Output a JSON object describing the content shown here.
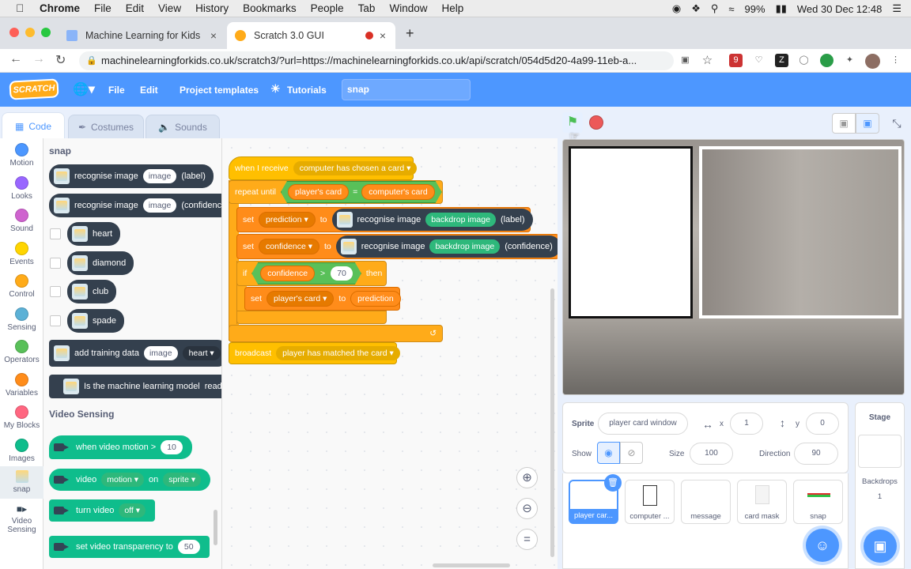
{
  "mac": {
    "apple": "",
    "app": "Chrome",
    "menus": [
      "File",
      "Edit",
      "View",
      "History",
      "Bookmarks",
      "People",
      "Tab",
      "Window",
      "Help"
    ],
    "battery": "99%",
    "clock": "Wed 30 Dec  12:48"
  },
  "browser": {
    "tabs": [
      {
        "title": "Machine Learning for Kids"
      },
      {
        "title": "Scratch 3.0 GUI"
      }
    ],
    "url": "machinelearningforkids.co.uk/scratch3/?url=https://machinelearningforkids.co.uk/api/scratch/054d5d20-4a99-11eb-a...",
    "ext_badge": "9"
  },
  "menubar": {
    "logo": "SCRATCH",
    "file": "File",
    "edit": "Edit",
    "templates": "Project templates",
    "tutorials": "Tutorials",
    "project_name": "snap"
  },
  "editor_tabs": {
    "code": "Code",
    "costumes": "Costumes",
    "sounds": "Sounds"
  },
  "categories": [
    {
      "label": "Motion",
      "color": "#4c97ff"
    },
    {
      "label": "Looks",
      "color": "#9966ff"
    },
    {
      "label": "Sound",
      "color": "#cf63cf"
    },
    {
      "label": "Events",
      "color": "#ffd500"
    },
    {
      "label": "Control",
      "color": "#ffab19"
    },
    {
      "label": "Sensing",
      "color": "#5cb1d6"
    },
    {
      "label": "Operators",
      "color": "#59c059"
    },
    {
      "label": "Variables",
      "color": "#ff8c1a"
    },
    {
      "label": "My Blocks",
      "color": "#ff6680"
    },
    {
      "label": "Images",
      "color": "#0fbd8c"
    },
    {
      "label": "snap",
      "color": "#34404e"
    },
    {
      "label": "Video Sensing",
      "color": "#0fbd8c"
    }
  ],
  "palette": {
    "snap_header": "snap",
    "recognise_label": {
      "text": "recognise image",
      "arg": "image",
      "suffix": "(label)"
    },
    "recognise_conf": {
      "text": "recognise image",
      "arg": "image",
      "suffix": "(confidence"
    },
    "labels": [
      "heart",
      "diamond",
      "club",
      "spade"
    ],
    "add_training": {
      "text": "add training data",
      "arg": "image",
      "dropdown": "heart ▾"
    },
    "is_ml": {
      "text": "Is the machine learning model",
      "suffix": "read"
    },
    "video_header": "Video Sensing",
    "when_motion": {
      "text": "when video motion >",
      "value": "10"
    },
    "video_on": {
      "text": "video",
      "dd1": "motion ▾",
      "on": "on",
      "dd2": "sprite ▾"
    },
    "turn_video": {
      "text": "turn video",
      "dd": "off ▾"
    },
    "transparency": {
      "text": "set video transparency to",
      "value": "50"
    }
  },
  "script": {
    "hat": {
      "text": "when I receive",
      "dd": "computer has chosen a card ▾"
    },
    "repeat": {
      "text": "repeat until",
      "left": "player's card",
      "op": "=",
      "right": "computer's card"
    },
    "set_pred": {
      "set": "set",
      "var": "prediction ▾",
      "to": "to",
      "rec": "recognise image",
      "arg": "backdrop image",
      "suffix": "(label)"
    },
    "set_conf": {
      "set": "set",
      "var": "confidence ▾",
      "to": "to",
      "rec": "recognise image",
      "arg": "backdrop image",
      "suffix": "(confidence)"
    },
    "if": {
      "text": "if",
      "var": "confidence",
      "op": ">",
      "val": "70",
      "then": "then"
    },
    "set_card": {
      "set": "set",
      "var": "player's card ▾",
      "to": "to",
      "val": "prediction"
    },
    "broadcast": {
      "text": "broadcast",
      "dd": "player has matched the card ▾"
    }
  },
  "zoom": {
    "in": "⊕",
    "out": "⊖",
    "reset": "="
  },
  "sprite": {
    "label": "Sprite",
    "name": "player card window",
    "x_label": "x",
    "x": "1",
    "y_label": "y",
    "y": "0",
    "show": "Show",
    "size_label": "Size",
    "size": "100",
    "dir_label": "Direction",
    "dir": "90"
  },
  "sprites": [
    "player car...",
    "computer ...",
    "message",
    "card mask",
    "snap"
  ],
  "stage": {
    "title": "Stage",
    "backdrops": "Backdrops",
    "count": "1"
  }
}
